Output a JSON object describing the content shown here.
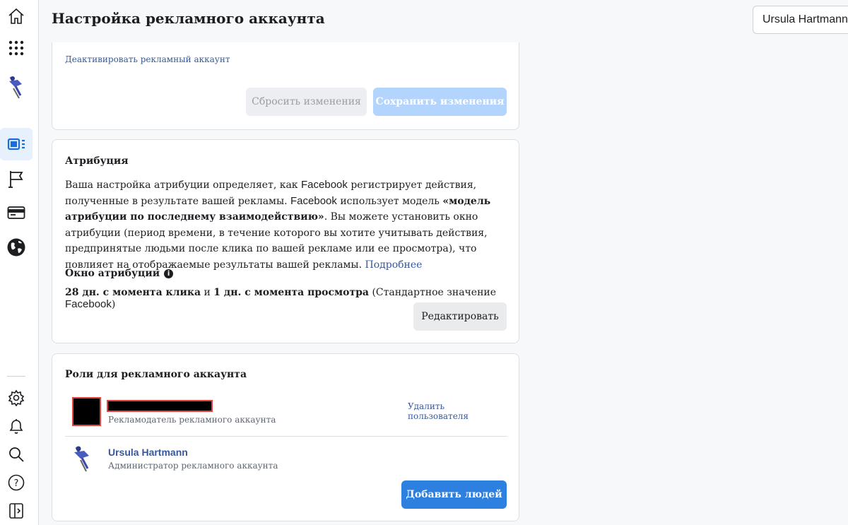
{
  "header": {
    "title": "Настройка рекламного аккаунта",
    "user_name": "Ursula Hartmann"
  },
  "sidebar": {
    "icons": [
      "home-icon",
      "apps-grid-icon",
      "profile-avatar-icon",
      "ads-manager-icon",
      "pages-flag-icon",
      "billing-card-icon",
      "globe-icon",
      "settings-gear-icon",
      "notifications-bell-icon",
      "search-icon",
      "help-icon",
      "collapse-panel-icon"
    ]
  },
  "account_card": {
    "deactivate_link": "Деактивировать рекламный аккаунт",
    "reset_label": "Сбросить изменения",
    "save_label": "Сохранить изменения"
  },
  "attribution": {
    "title": "Атрибуция",
    "para_1": "Ваша настройка атрибуции определяет, как ",
    "brand_1": "Facebook",
    "para_2": " регистрирует действия, полученные в результате вашей рекламы. ",
    "brand_2": "Facebook",
    "para_3": " использует модель ",
    "para_bold": "«модель атрибуции по последнему взаимодействию»",
    "para_4": ". Вы можете установить окно атрибуции (период времени, в течение которого вы хотите учитывать действия, предпринятые людьми после клика по вашей рекламе или ее просмотра), что повлияет на отображаемые результаты вашей рекламы. ",
    "learn_more": "Подробнее",
    "window_title": "Окно атрибуции",
    "click_days": "28 дн. с момента клика",
    "and": " и ",
    "view_days": "1 дн. с момента просмотра",
    "default_prefix": " (Стандартное значение ",
    "default_brand": "Facebook",
    "default_suffix": ")",
    "edit_label": "Редактировать"
  },
  "roles": {
    "title": "Роли для рекламного аккаунта",
    "users": [
      {
        "name": "",
        "role": "Рекламодатель рекламного аккаунта",
        "action": "Удалить пользователя"
      },
      {
        "name": "Ursula Hartmann",
        "role": "Администратор рекламного аккаунта"
      }
    ],
    "add_label": "Добавить людей"
  }
}
